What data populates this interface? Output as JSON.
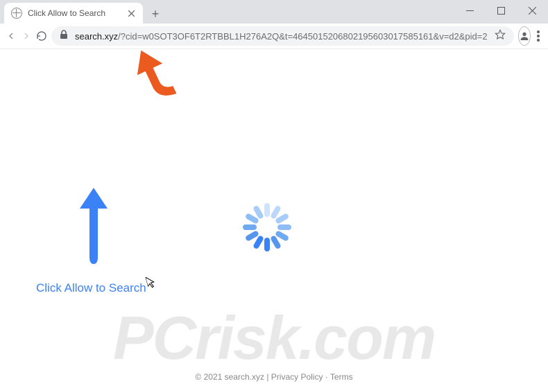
{
  "window": {
    "tab_title": "Click Allow to Search"
  },
  "toolbar": {
    "url_host": "search.xyz",
    "url_rest": "/?cid=w0SOT3OF6T2RTBBL1H276A2Q&t=4645015206802195603017585161&v=d2&pid=2"
  },
  "page": {
    "hint_text": "Click Allow to Search",
    "footer_text": "© 2021 search.xyz | Privacy Policy · Terms"
  },
  "colors": {
    "blue": "#3b82f6",
    "orange": "#eb5a1f",
    "spinner_light": "#cfe3fb",
    "spinner_dark": "#3b82f6"
  },
  "watermark": {
    "text": "PCrisk.com"
  }
}
